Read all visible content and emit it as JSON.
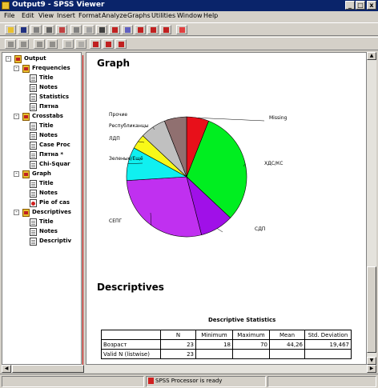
{
  "window": {
    "title": "Output9 - SPSS Viewer",
    "buttons": [
      "_",
      "□",
      "x"
    ]
  },
  "menu": [
    "File",
    "Edit",
    "View",
    "Insert",
    "Format",
    "Analyze",
    "Graphs",
    "Utilities",
    "Window",
    "Help"
  ],
  "outline": {
    "nodes": [
      {
        "label": "Output",
        "level": 0,
        "icon": "book",
        "expand": "-"
      },
      {
        "label": "Frequencies",
        "level": 1,
        "icon": "book",
        "expand": "-"
      },
      {
        "label": "Title",
        "level": 2,
        "icon": "page"
      },
      {
        "label": "Notes",
        "level": 2,
        "icon": "page"
      },
      {
        "label": "Statistics",
        "level": 2,
        "icon": "page"
      },
      {
        "label": "Пятна",
        "level": 2,
        "icon": "page"
      },
      {
        "label": "Crosstabs",
        "level": 1,
        "icon": "book",
        "expand": "-"
      },
      {
        "label": "Title",
        "level": 2,
        "icon": "page"
      },
      {
        "label": "Notes",
        "level": 2,
        "icon": "page"
      },
      {
        "label": "Case Proc",
        "level": 2,
        "icon": "page"
      },
      {
        "label": "Пятна *",
        "level": 2,
        "icon": "page"
      },
      {
        "label": "Chi-Squar",
        "level": 2,
        "icon": "page"
      },
      {
        "label": "Graph",
        "level": 1,
        "icon": "book",
        "expand": "-"
      },
      {
        "label": "Title",
        "level": 2,
        "icon": "page"
      },
      {
        "label": "Notes",
        "level": 2,
        "icon": "page"
      },
      {
        "label": "Pie of cas",
        "level": 2,
        "icon": "chart"
      },
      {
        "label": "Descriptives",
        "level": 1,
        "icon": "book",
        "expand": "-"
      },
      {
        "label": "Title",
        "level": 2,
        "icon": "page"
      },
      {
        "label": "Notes",
        "level": 2,
        "icon": "page"
      },
      {
        "label": "Descriptiv",
        "level": 2,
        "icon": "page"
      }
    ]
  },
  "content": {
    "graph_heading": "Graph",
    "descriptives_heading": "Descriptives",
    "table_title": "Descriptive Statistics",
    "table_headers": [
      "",
      "N",
      "Minimum",
      "Maximum",
      "Mean",
      "Std. Deviation"
    ],
    "table_rows": [
      [
        "Возраст",
        "23",
        "18",
        "70",
        "44,26",
        "19,467"
      ],
      [
        "Valid N (listwise)",
        "23",
        "",
        "",
        "",
        ""
      ]
    ]
  },
  "chart_data": {
    "type": "pie",
    "slices": [
      {
        "label": "Missing",
        "value": 6,
        "color": "#e8101a"
      },
      {
        "label": "ХДС/КС",
        "value": 31,
        "color": "#00ee20"
      },
      {
        "label": "СДП",
        "value": 9,
        "color": "#a010e8"
      },
      {
        "label": "СЕПГ",
        "value": 28,
        "color": "#c030f0"
      },
      {
        "label": "Зеленые/Ещё",
        "value": 9,
        "color": "#10f0f0"
      },
      {
        "label": "ЛДП",
        "value": 4,
        "color": "#f8f818"
      },
      {
        "label": "Республиканцы",
        "value": 7,
        "color": "#c0c0c0"
      },
      {
        "label": "Прочие",
        "value": 6,
        "color": "#907070"
      }
    ]
  },
  "status": {
    "text": "SPSS Processor  is ready"
  }
}
